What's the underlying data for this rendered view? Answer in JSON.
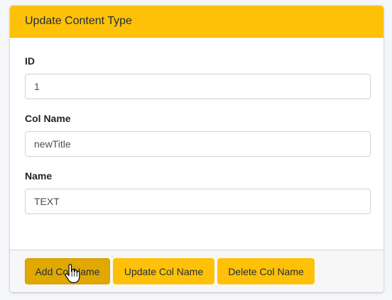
{
  "card": {
    "title": "Update Content Type"
  },
  "form": {
    "id": {
      "label": "ID",
      "value": "1"
    },
    "col_name": {
      "label": "Col Name",
      "value": "newTitle"
    },
    "name": {
      "label": "Name",
      "value": "TEXT"
    }
  },
  "footer": {
    "add_label": "Add Col Name",
    "update_label": "Update Col Name",
    "delete_label": "Delete Col Name"
  },
  "colors": {
    "accent": "#ffc107",
    "accent_active": "#e0a800"
  },
  "icons": {
    "cursor": "hand-pointer-icon"
  }
}
